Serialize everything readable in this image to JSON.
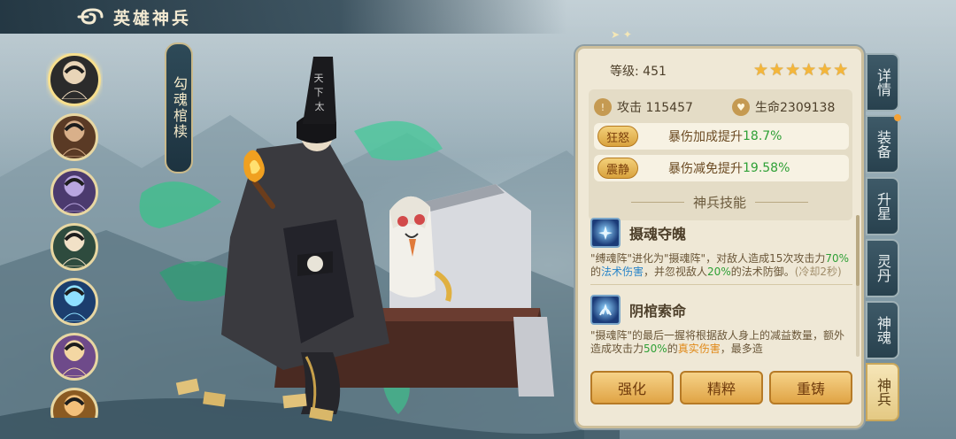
{
  "header": {
    "title": "英雄神兵"
  },
  "heroes": [
    {
      "id": "hero-1",
      "color": "#2b2b2b",
      "accent": "#e9d5b8",
      "active": true
    },
    {
      "id": "hero-2",
      "color": "#5a3a25",
      "accent": "#d9b08a",
      "active": false
    },
    {
      "id": "hero-3",
      "color": "#4b3a6e",
      "accent": "#b9a6e0",
      "active": false
    },
    {
      "id": "hero-4",
      "color": "#2e4b3e",
      "accent": "#f2e1c7",
      "active": false
    },
    {
      "id": "hero-5",
      "color": "#1c3e6e",
      "accent": "#8fe0ff",
      "active": false
    },
    {
      "id": "hero-6",
      "color": "#6e4a8a",
      "accent": "#f4d7a3",
      "active": false
    },
    {
      "id": "hero-7",
      "color": "#8a5a22",
      "accent": "#f4c07a",
      "active": false
    }
  ],
  "weapon": {
    "name": "勾魂棺椟"
  },
  "panel": {
    "level_label": "等级: 451",
    "stars": 6,
    "stats": {
      "attack_label": "攻击 115457",
      "hp_label": "生命2309138"
    },
    "effects": [
      {
        "tag": "狂怒",
        "text": "暴伤加成提升",
        "value": "18.7%"
      },
      {
        "tag": "震静",
        "text": "暴伤减免提升",
        "value": "19.58%"
      }
    ],
    "section_title": "神兵技能",
    "skills": [
      {
        "name": "摄魂夺魄",
        "desc_1": "\"缚魂阵\"进化为\"摄魂阵\"，对敌人造成15次攻击力",
        "desc_pct1": "70%",
        "desc_2": "的",
        "desc_dmg": "法术伤害",
        "desc_3": "，并忽视敌人",
        "desc_pct2": "20%",
        "desc_4": "的法术防御。",
        "desc_cd": "(冷却2秒)"
      },
      {
        "name": "阴棺索命",
        "desc_1": "\"摄魂阵\"的最后一握将根据敌人身上的减益数量，额外造成攻击力",
        "desc_pct1": "50%",
        "desc_2": "的",
        "desc_dmg": "真实伤害",
        "desc_3": "，最多造"
      }
    ],
    "actions": {
      "strengthen": "强化",
      "refine": "精粹",
      "recast": "重铸"
    }
  },
  "tabs": [
    {
      "label": "详情",
      "active": false,
      "dot": false
    },
    {
      "label": "装备",
      "active": false,
      "dot": true
    },
    {
      "label": "升星",
      "active": false,
      "dot": false
    },
    {
      "label": "灵丹",
      "active": false,
      "dot": false
    },
    {
      "label": "神魂",
      "active": false,
      "dot": false
    },
    {
      "label": "神兵",
      "active": true,
      "dot": false
    }
  ],
  "colors": {
    "accent_gold": "#f4b63a",
    "panel_bg": "#efe8d6",
    "value_green": "#2fa036"
  }
}
